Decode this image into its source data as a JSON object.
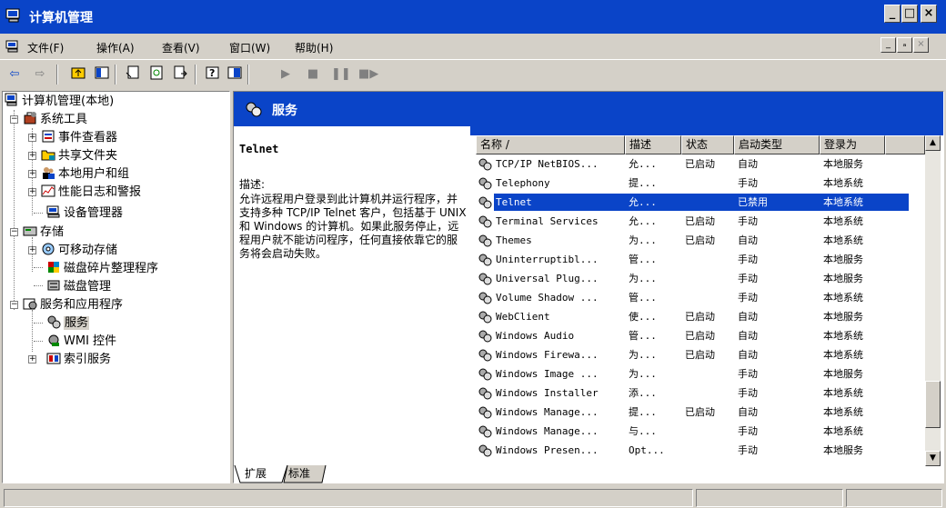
{
  "window": {
    "title": "计算机管理",
    "buttons": [
      "_",
      "□",
      "×"
    ]
  },
  "menu": {
    "items": [
      "文件(F)",
      "操作(A)",
      "查看(V)",
      "窗口(W)",
      "帮助(H)"
    ],
    "mdi_buttons": [
      "_",
      "ₐ",
      "×"
    ]
  },
  "tree": {
    "root": "计算机管理(本地)",
    "system_tools": "系统工具",
    "event_viewer": "事件查看器",
    "shared_folders": "共享文件夹",
    "local_users": "本地用户和组",
    "perf_logs": "性能日志和警报",
    "device_manager": "设备管理器",
    "storage": "存储",
    "removable": "可移动存储",
    "defrag": "磁盘碎片整理程序",
    "disk_mgmt": "磁盘管理",
    "services_apps": "服务和应用程序",
    "services": "服务",
    "wmi": "WMI 控件",
    "indexing": "索引服务"
  },
  "panel": {
    "title": "服务",
    "selected_service": "Telnet",
    "description_label": "描述:",
    "description": "允许远程用户登录到此计算机并运行程序，并支持多种 TCP/IP Telnet 客户，包括基于 UNIX 和 Windows 的计算机。如果此服务停止，远程用户就不能访问程序，任何直接依靠它的服务将会启动失败。"
  },
  "list": {
    "headers": [
      "名称 /",
      "描述",
      "状态",
      "启动类型",
      "登录为"
    ],
    "rows": [
      {
        "name": "TCP/IP NetBIOS...",
        "desc": "允...",
        "status": "已启动",
        "startup": "自动",
        "logon": "本地服务"
      },
      {
        "name": "Telephony",
        "desc": "提...",
        "status": "",
        "startup": "手动",
        "logon": "本地系统"
      },
      {
        "name": "Telnet",
        "desc": "允...",
        "status": "",
        "startup": "已禁用",
        "logon": "本地系统"
      },
      {
        "name": "Terminal Services",
        "desc": "允...",
        "status": "已启动",
        "startup": "手动",
        "logon": "本地系统"
      },
      {
        "name": "Themes",
        "desc": "为...",
        "status": "已启动",
        "startup": "自动",
        "logon": "本地系统"
      },
      {
        "name": "Uninterruptibl...",
        "desc": "管...",
        "status": "",
        "startup": "手动",
        "logon": "本地服务"
      },
      {
        "name": "Universal Plug...",
        "desc": "为...",
        "status": "",
        "startup": "手动",
        "logon": "本地服务"
      },
      {
        "name": "Volume Shadow ...",
        "desc": "管...",
        "status": "",
        "startup": "手动",
        "logon": "本地系统"
      },
      {
        "name": "WebClient",
        "desc": "使...",
        "status": "已启动",
        "startup": "自动",
        "logon": "本地服务"
      },
      {
        "name": "Windows Audio",
        "desc": "管...",
        "status": "已启动",
        "startup": "自动",
        "logon": "本地系统"
      },
      {
        "name": "Windows Firewa...",
        "desc": "为...",
        "status": "已启动",
        "startup": "自动",
        "logon": "本地系统"
      },
      {
        "name": "Windows Image ...",
        "desc": "为...",
        "status": "",
        "startup": "手动",
        "logon": "本地服务"
      },
      {
        "name": "Windows Installer",
        "desc": "添...",
        "status": "",
        "startup": "手动",
        "logon": "本地系统"
      },
      {
        "name": "Windows Manage...",
        "desc": "提...",
        "status": "已启动",
        "startup": "自动",
        "logon": "本地系统"
      },
      {
        "name": "Windows Manage...",
        "desc": "与...",
        "status": "",
        "startup": "手动",
        "logon": "本地系统"
      },
      {
        "name": "Windows Presen...",
        "desc": "Opt...",
        "status": "",
        "startup": "手动",
        "logon": "本地服务"
      }
    ],
    "selected_index": 2
  },
  "tabs": [
    "扩展",
    "标准"
  ],
  "colors": {
    "accent": "#0a44c8",
    "face": "#d4d0c8"
  },
  "icons": {
    "app": "computer-management-icon",
    "service": "gear-icon"
  }
}
